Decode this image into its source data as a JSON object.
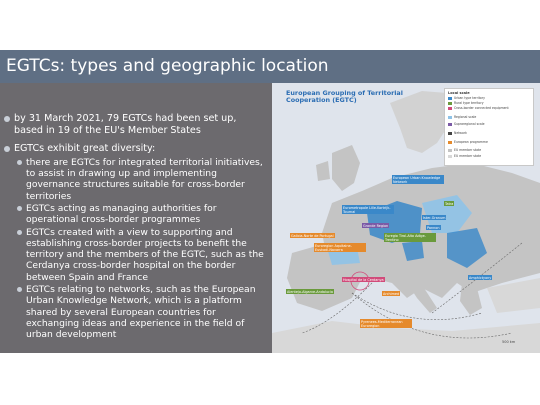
{
  "title": "EGTCs: types and geographic location",
  "bullets": [
    {
      "text": "by 31 March 2021, 79 EGTCs had been set up, based in 19 of the EU's Member States",
      "children": []
    },
    {
      "text": "EGTCs exhibit great diversity:",
      "children": [
        " there are EGTCs for integrated territorial initiatives, to assist in drawing up and implementing governance structures suitable for cross-border territories",
        "EGTCs acting as managing authorities for operational cross-border programmes",
        "EGTCs created with a view to supporting and establishing cross-border projects to benefit the territory and the members of the EGTC, such as the Cerdanya cross-border hospital on the border between Spain and France",
        "EGTCs relating to networks, such as the European Urban Knowledge Network, which is a platform shared by several European countries for exchanging ideas and experience in the field of urban development"
      ]
    }
  ],
  "map": {
    "title": "European Grouping of Territorial Cooperation (EGTC)",
    "legend_heading": "Local scale",
    "legend_items": [
      "Urban type territory",
      "Rural type territory",
      "Cross-border connected equipment",
      "Regional scale",
      "Supraregional scale",
      "Network",
      "European programme",
      "EU member state",
      "EU member state"
    ],
    "scale_label": "500 km",
    "colors": {
      "sea": "#dfe4ec",
      "land_eu": "#c4c4c4",
      "land_non_eu": "#d8d8d8",
      "egtc_blue": "#3a88c9",
      "egtc_light_blue": "#8fc3e8",
      "label_orange": "#e58a2c",
      "label_green": "#6a9a3c",
      "label_pink": "#d14b7a",
      "label_purple": "#7b5aa6"
    },
    "labels": [
      {
        "text": "European Urban Knowledge Network",
        "color": "#ffffff",
        "bg": "#3a88c9"
      },
      {
        "text": "Archimed",
        "color": "#ffffff",
        "bg": "#e58a2c"
      },
      {
        "text": "Tatra",
        "color": "#ffffff",
        "bg": "#6a9a3c"
      },
      {
        "text": "Hospital de la Cerdanya",
        "color": "#ffffff",
        "bg": "#d14b7a"
      },
      {
        "text": "Pyrenees-Mediterranean Euroregion",
        "color": "#ffffff",
        "bg": "#e58a2c"
      },
      {
        "text": "Eurometropole Lille-Kortrijk-Tournai",
        "color": "#ffffff",
        "bg": "#3a88c9"
      },
      {
        "text": "Grande Region",
        "color": "#ffffff",
        "bg": "#7b5aa6"
      },
      {
        "text": "Amphictyony",
        "color": "#ffffff",
        "bg": "#3a88c9"
      },
      {
        "text": "Euroregion Aquitaine-Euskadi-Navarra",
        "color": "#ffffff",
        "bg": "#e58a2c"
      },
      {
        "text": "Galicia-Norte de Portugal",
        "color": "#ffffff",
        "bg": "#e58a2c"
      },
      {
        "text": "Alentejo-Algarve-Andalucia",
        "color": "#ffffff",
        "bg": "#6a9a3c"
      },
      {
        "text": "Ister-Granum",
        "color": "#ffffff",
        "bg": "#3a88c9"
      },
      {
        "text": "Euregio Tirol-Alto Adige-Trentino",
        "color": "#ffffff",
        "bg": "#6a9a3c"
      },
      {
        "text": "Pannon",
        "color": "#ffffff",
        "bg": "#3a88c9"
      }
    ]
  }
}
